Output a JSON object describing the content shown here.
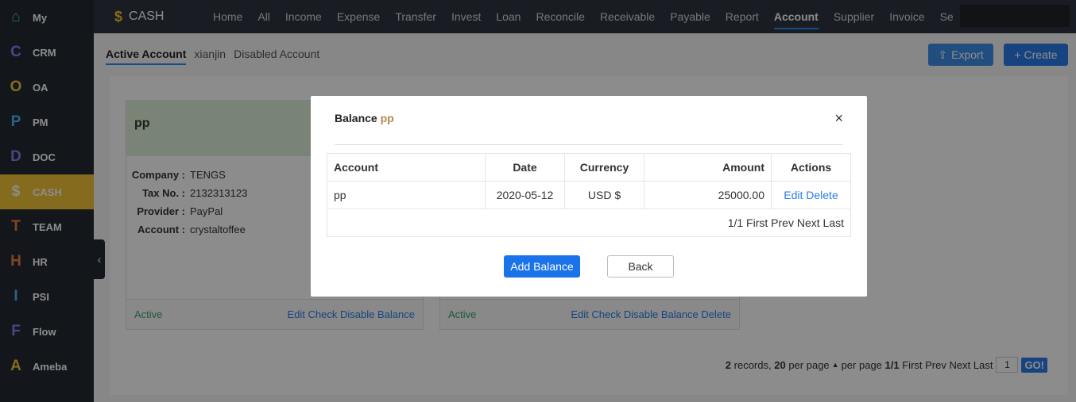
{
  "sidebar": {
    "items": [
      {
        "letter": "⌂",
        "label": "My",
        "color": "#4fb4f0"
      },
      {
        "letter": "C",
        "label": "CRM",
        "color": "#8e7cf0"
      },
      {
        "letter": "O",
        "label": "OA",
        "color": "#f3c437"
      },
      {
        "letter": "P",
        "label": "PM",
        "color": "#4fb4f0"
      },
      {
        "letter": "D",
        "label": "DOC",
        "color": "#8e7cf0"
      },
      {
        "letter": "$",
        "label": "CASH",
        "color": "#ffffff"
      },
      {
        "letter": "T",
        "label": "TEAM",
        "color": "#f27d3a"
      },
      {
        "letter": "H",
        "label": "HR",
        "color": "#f27d3a"
      },
      {
        "letter": "I",
        "label": "PSI",
        "color": "#4fb4f0"
      },
      {
        "letter": "F",
        "label": "Flow",
        "color": "#8e7cf0"
      },
      {
        "letter": "A",
        "label": "Ameba",
        "color": "#f3c437"
      }
    ],
    "active_index": 5,
    "collapse_icon": "‹"
  },
  "topnav": {
    "brand": "CASH",
    "brand_icon": "$",
    "items": [
      "Home",
      "All",
      "Income",
      "Expense",
      "Transfer",
      "Invest",
      "Loan",
      "Reconcile",
      "Receivable",
      "Payable",
      "Report",
      "Account",
      "Supplier",
      "Invoice",
      "Se"
    ],
    "active": "Account"
  },
  "subtabs": {
    "active": "Active Account",
    "xianjin": "xianjin",
    "disabled": "Disabled Account"
  },
  "toolbar": {
    "export": "Export",
    "create": "+ Create"
  },
  "card1": {
    "title": "pp",
    "company_label": "Company :",
    "company": "TENGS",
    "tax_label": "Tax No. :",
    "tax": "2132313123",
    "provider_label": "Provider :",
    "provider": "PayPal",
    "account_label": "Account :",
    "account": "crystaltoffee",
    "status": "Active",
    "edit": "Edit",
    "check": "Check",
    "disable": "Disable",
    "balance": "Balance"
  },
  "card2": {
    "status": "Active",
    "edit": "Edit",
    "check": "Check",
    "disable": "Disable",
    "balance": "Balance",
    "delete": "Delete"
  },
  "pager": {
    "records": "2",
    "records_label": "records,",
    "per_page": "20",
    "per_page_label": "per page",
    "per_page_label2": "per page",
    "page": "1/1",
    "first": "First",
    "prev": "Prev",
    "next": "Next",
    "last": "Last",
    "input": "1",
    "go": "GO!"
  },
  "modal": {
    "title": "Balance",
    "account_name": "pp",
    "close": "×",
    "columns": [
      "Account",
      "Date",
      "Currency",
      "Amount",
      "Actions"
    ],
    "rows": [
      {
        "account": "pp",
        "date": "2020-05-12",
        "currency": "USD $",
        "amount": "25000.00",
        "edit": "Edit",
        "delete": "Delete"
      }
    ],
    "pager": {
      "page": "1/1",
      "first": "First",
      "prev": "Prev",
      "next": "Next",
      "last": "Last"
    },
    "add_button": "Add Balance",
    "back_button": "Back"
  }
}
